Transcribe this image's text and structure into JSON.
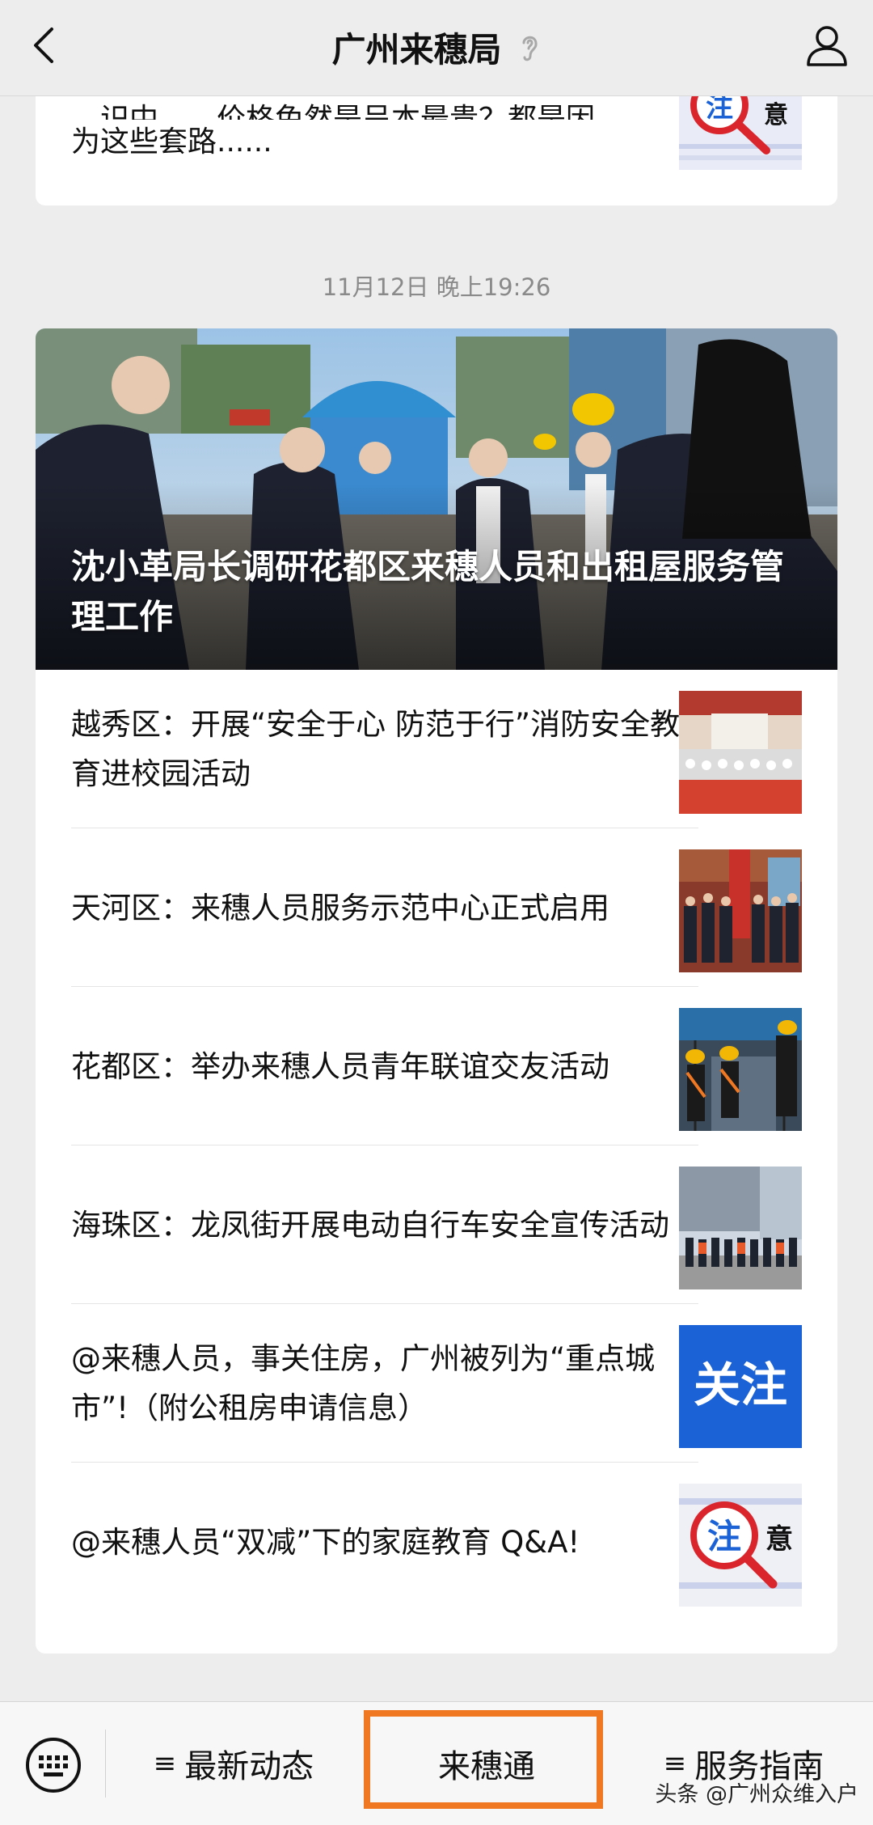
{
  "header": {
    "title": "广州来穗局"
  },
  "previous_card": {
    "text_cut": "…识中……价格免然是呈本最贵？都是因",
    "text": "为这些套路......"
  },
  "timestamp": "11月12日 晚上19:26",
  "hero": {
    "title": "沈小革局长调研花都区来穗人员和出租屋服务管理工作"
  },
  "articles": [
    {
      "title": "越秀区：开展“安全于心 防范于行”消防安全教育进校园活动"
    },
    {
      "title": "天河区：来穗人员服务示范中心正式启用"
    },
    {
      "title": "花都区：举办来穗人员青年联谊交友活动"
    },
    {
      "title": "海珠区：龙凤街开展电动自行车安全宣传活动"
    },
    {
      "title": "@来穗人员，事关住房，广州被列为“重点城市”!（附公租房申请信息）",
      "thumb_text": "关注"
    },
    {
      "title": "@来穗人员“双减”下的家庭教育 Q&A!",
      "thumb_text_a": "注",
      "thumb_text_b": "意"
    }
  ],
  "top_thumb": {
    "text_a": "注",
    "text_b": "意"
  },
  "bottom_menu": {
    "item1": "最新动态",
    "item2": "来穗通",
    "item3": "服务指南",
    "hamburger": "≡"
  },
  "watermark": "头条 @广州众维入户",
  "colors": {
    "highlight": "#f07822",
    "attention_blue": "#1b62d6",
    "magnifier_red": "#d9252b"
  }
}
